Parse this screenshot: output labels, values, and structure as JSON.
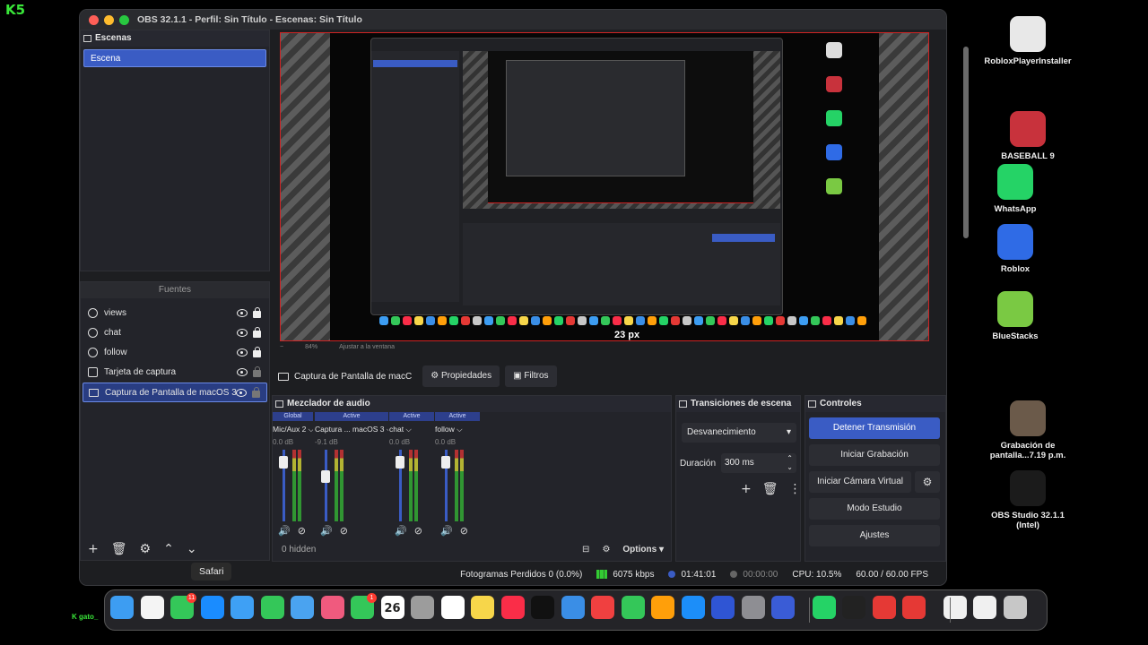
{
  "overlay": {
    "logo": "K5",
    "bottom_logo": "K gato_"
  },
  "window": {
    "title": "OBS 32.1.1 - Perfil: Sin Título - Escenas: Sin Título"
  },
  "scenes": {
    "title": "Escenas",
    "items": [
      {
        "label": "Escena"
      }
    ]
  },
  "sources": {
    "title": "Fuentes",
    "items": [
      {
        "label": "views",
        "icon": "globe-icon",
        "locked": true
      },
      {
        "label": "chat",
        "icon": "globe-icon",
        "locked": true
      },
      {
        "label": "follow",
        "icon": "globe-icon",
        "locked": true
      },
      {
        "label": "Tarjeta de captura",
        "icon": "camera-icon",
        "locked": false
      },
      {
        "label": "Captura de Pantalla de macOS 3",
        "icon": "monitor-icon",
        "locked": false
      }
    ],
    "toolbar": [
      "+",
      "🗑",
      "⚙",
      "⌃",
      "⌄"
    ]
  },
  "preview": {
    "measure": "23 px",
    "zoom": "84%",
    "fit": "Ajustar a la ventana"
  },
  "source_toolbar": {
    "label": "Captura de Pantalla de macC",
    "properties": "Propiedades",
    "filters": "Filtros"
  },
  "mixer": {
    "title": "Mezclador de audio",
    "channels": [
      {
        "tag": "Global",
        "name": "Mic/Aux 2 ⌵",
        "db": "0.0 dB",
        "level": 0.9
      },
      {
        "tag": "Active",
        "name": "Captura ... macOS 3 ⌵",
        "db": "-9.1 dB",
        "level": 0.65
      },
      {
        "tag": "Active",
        "name": "chat ⌵",
        "db": "0.0 dB",
        "level": 0.9
      },
      {
        "tag": "Active",
        "name": "follow ⌵",
        "db": "0.0 dB",
        "level": 0.9
      }
    ],
    "hidden": "0 hidden",
    "options": "Options"
  },
  "transitions": {
    "title": "Transiciones de escena",
    "selected": "Desvanecimiento",
    "duration_label": "Duración",
    "duration": "300 ms"
  },
  "controls": {
    "title": "Controles",
    "stop_stream": "Detener Transmisión",
    "start_recording": "Iniciar Grabación",
    "virtual_cam": "Iniciar Cámara Virtual",
    "studio_mode": "Modo Estudio",
    "settings": "Ajustes"
  },
  "status": {
    "dropped": "Fotogramas Perdidos 0 (0.0%)",
    "kbps": "6075 kbps",
    "stream_time": "01:41:01",
    "rec_time": "00:00:00",
    "cpu": "CPU: 10.5%",
    "fps": "60.00 / 60.00 FPS"
  },
  "desktop": [
    {
      "label": "RobloxPlayerInstaller",
      "color": "#e8e8e8"
    },
    {
      "label": "BASEBALL 9",
      "color": "#c8323c"
    },
    {
      "label": "WhatsApp",
      "color": "#25d366"
    },
    {
      "label": "Roblox",
      "color": "#2f6be6"
    },
    {
      "label": "BlueStacks",
      "color": "#7ac943"
    },
    {
      "label": "Grabación de pantalla...7.19 p.m.",
      "color": "#6b5a4a"
    },
    {
      "label": "OBS Studio 32.1.1 (Intel)",
      "color": "#1b1b1b"
    }
  ],
  "tooltip": "Safari",
  "dock": {
    "calendar_month": "DOM",
    "calendar_day": "26",
    "apps": [
      "#3d9df2",
      "#f4f4f4",
      "#34c759",
      "#1a8cff",
      "#3ea0f5",
      "#34c759",
      "#4aa3f0",
      "#f05a7e",
      "#34c759",
      "#ffffff",
      "#9c9c9c",
      "#ffffff",
      "#f7d64a",
      "#fa2d48",
      "#111111",
      "#3a8ee6",
      "#f04040",
      "#34c759",
      "#ff9f0a",
      "#1c8ef9",
      "#2f55d4",
      "#8e8e93",
      "#3a5cd6",
      "#25d366",
      "#222222",
      "#e53935",
      "#e53935",
      "#f0f0f0",
      "#f0f0f0",
      "#c7c7c7"
    ],
    "badges": [
      "11",
      "1"
    ]
  }
}
